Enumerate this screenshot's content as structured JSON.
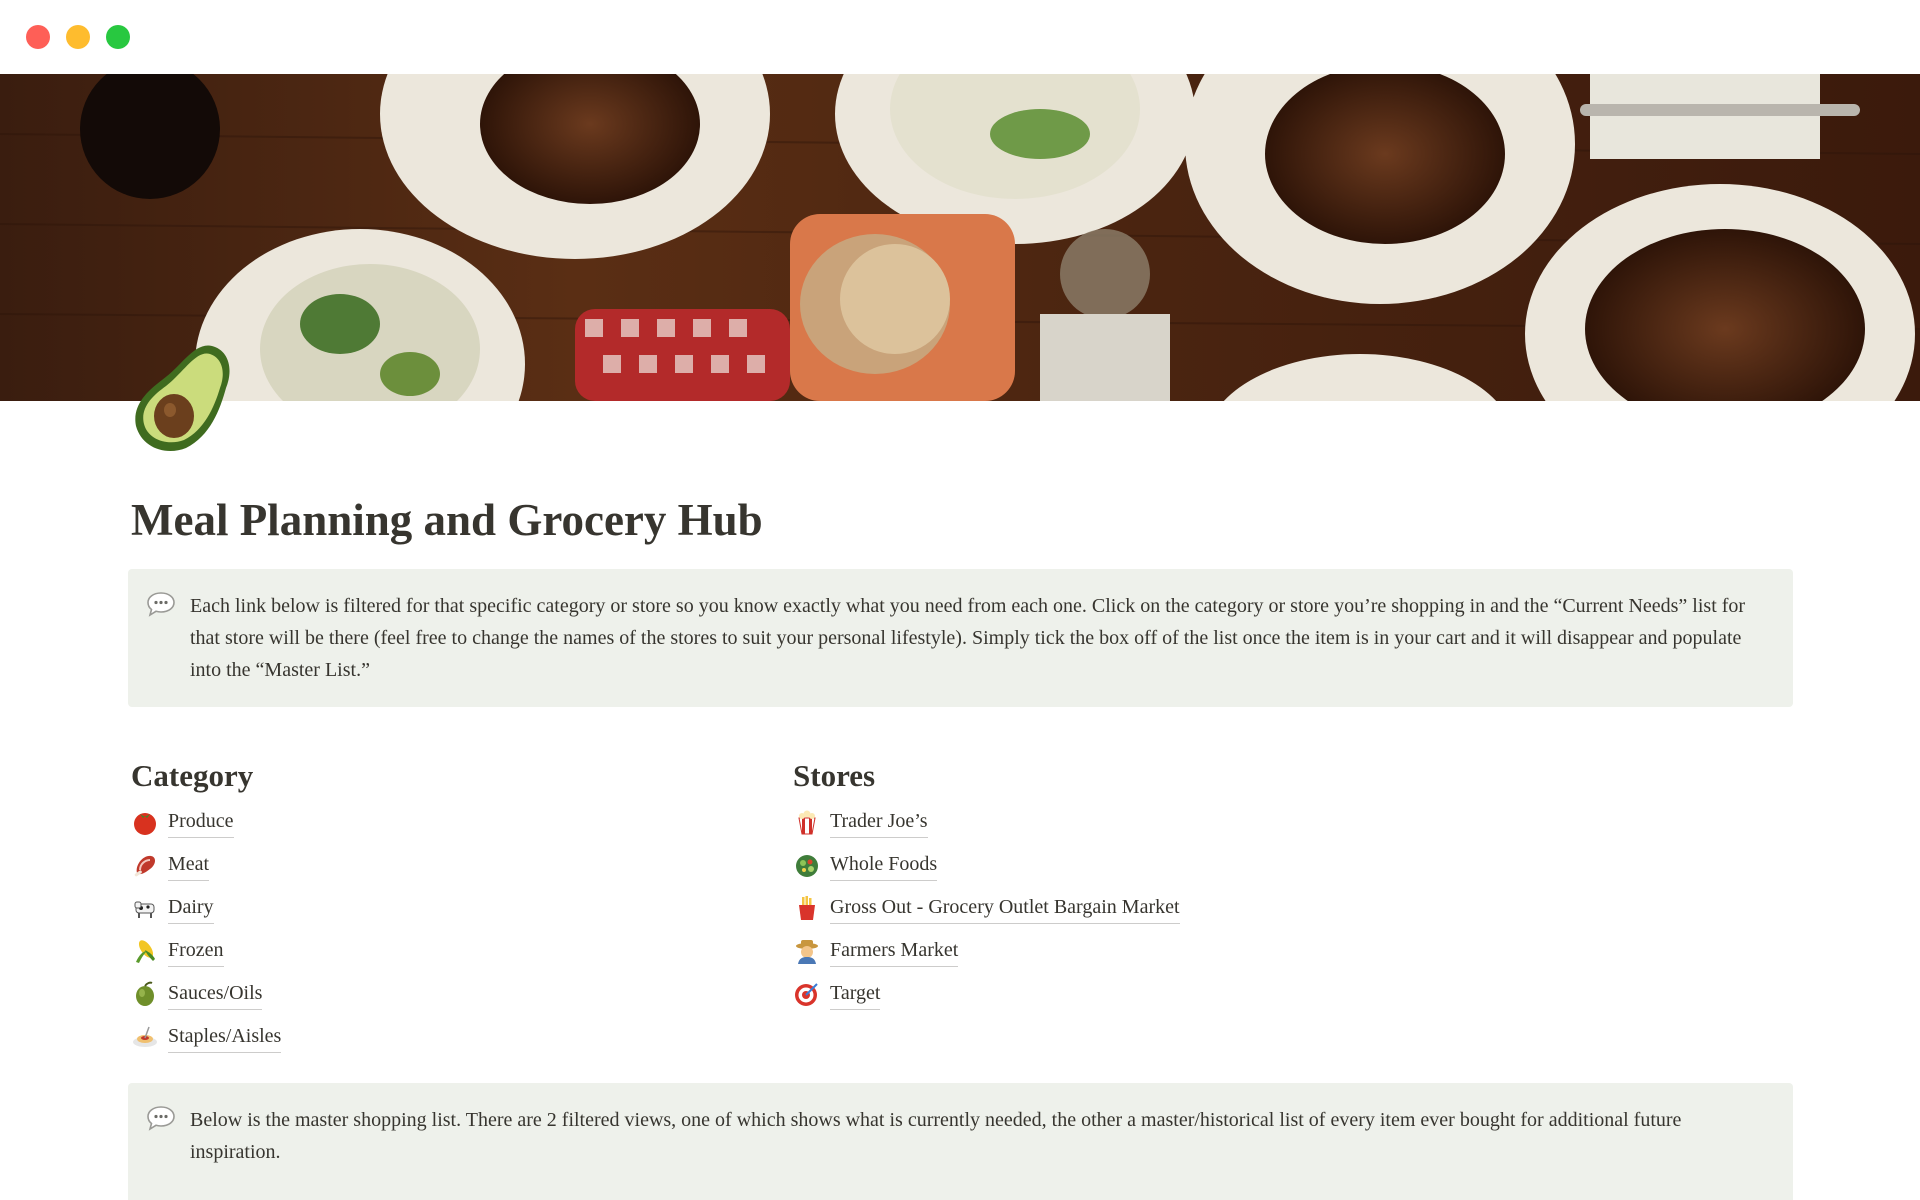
{
  "window": {
    "controls": [
      "close",
      "minimize",
      "zoom"
    ]
  },
  "page": {
    "icon": "avocado-icon",
    "title": "Meal Planning and Grocery Hub"
  },
  "callout_intro": {
    "icon": "speech-bubble-icon",
    "text": "Each link below is filtered for that specific category or store so you know exactly what you need from each one. Click on the category or store you’re shopping in and the “Current Needs” list for that store will be there (feel free to change the names of the stores to suit your personal lifestyle). Simply tick the box off of the list once the item is in your cart and it will disappear and populate into the “Master List.”"
  },
  "category": {
    "heading": "Category",
    "items": [
      {
        "label": "Produce",
        "icon": "tomato-icon"
      },
      {
        "label": "Meat",
        "icon": "meat-icon"
      },
      {
        "label": "Dairy",
        "icon": "cow-icon"
      },
      {
        "label": "Frozen",
        "icon": "corn-icon"
      },
      {
        "label": "Sauces/Oils",
        "icon": "olive-icon"
      },
      {
        "label": "Staples/Aisles",
        "icon": "spaghetti-icon"
      }
    ]
  },
  "stores": {
    "heading": "Stores",
    "items": [
      {
        "label": "Trader Joe’s",
        "icon": "popcorn-icon"
      },
      {
        "label": "Whole Foods",
        "icon": "salad-icon"
      },
      {
        "label": "Gross Out - Grocery Outlet Bargain Market",
        "icon": "fries-icon"
      },
      {
        "label": "Farmers Market",
        "icon": "farmer-icon"
      },
      {
        "label": "Target",
        "icon": "bullseye-icon"
      }
    ]
  },
  "callout_master": {
    "icon": "speech-bubble-icon",
    "text": "Below is the master shopping list. There are 2 filtered views, one of which shows what is currently needed, the other a master/historical list of every item ever bought for additional future inspiration."
  },
  "colors": {
    "callout_bg": "#eef1eb",
    "text": "#37352f",
    "close": "#fe5f57",
    "minimize": "#febc2e",
    "zoom": "#28c840"
  }
}
